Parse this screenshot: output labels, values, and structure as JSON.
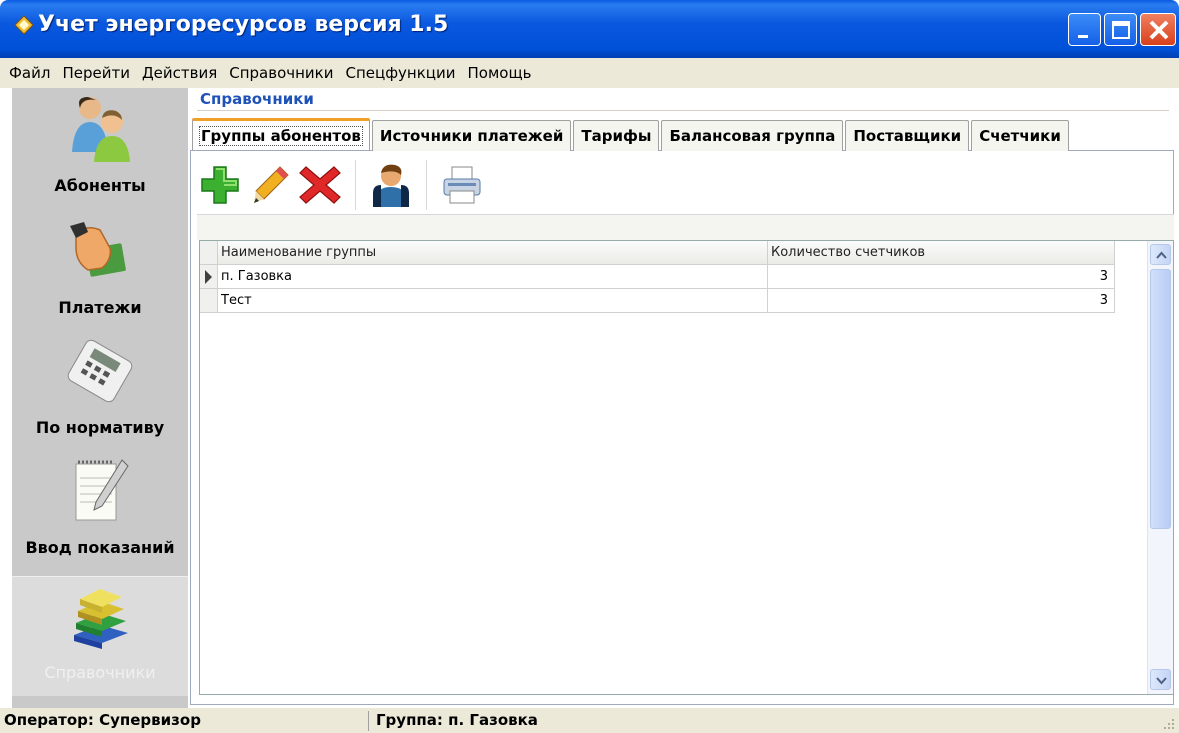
{
  "window": {
    "title": "Учет энергоресурсов версия 1.5"
  },
  "menu": [
    "Файл",
    "Перейти",
    "Действия",
    "Справочники",
    "Спецфункции",
    "Помощь"
  ],
  "sidebar": {
    "items": [
      {
        "label": "Абоненты",
        "icon": "users-icon"
      },
      {
        "label": "Платежи",
        "icon": "payment-hand-icon"
      },
      {
        "label": "По нормативу",
        "icon": "calculator-icon"
      },
      {
        "label": "Ввод показаний",
        "icon": "notepad-pencil-icon"
      },
      {
        "label": "Справочники",
        "icon": "books-icon",
        "active": true
      }
    ]
  },
  "section": {
    "title": "Справочники"
  },
  "tabs": [
    "Группы абонентов",
    "Источники платежей",
    "Тарифы",
    "Балансовая группа",
    "Поставщики",
    "Счетчики"
  ],
  "active_tab": "Группы абонентов",
  "toolbar": [
    "add-icon",
    "edit-pencil-icon",
    "delete-icon",
    "users-group-icon",
    "print-icon"
  ],
  "grid": {
    "columns": [
      "Наименование группы",
      "Количество счетчиков"
    ],
    "rows": [
      {
        "name": "п. Газовка",
        "count": "3",
        "selected": true
      },
      {
        "name": "Тест",
        "count": "3"
      }
    ]
  },
  "status": {
    "operator": "Оператор: Супервизор",
    "group": "Группа: п. Газовка"
  },
  "colors": {
    "titlebar": "#0a58df",
    "accent_tab": "#f0a028",
    "section_title": "#1f52b8",
    "sidebar_bg": "#c9c9c9"
  }
}
